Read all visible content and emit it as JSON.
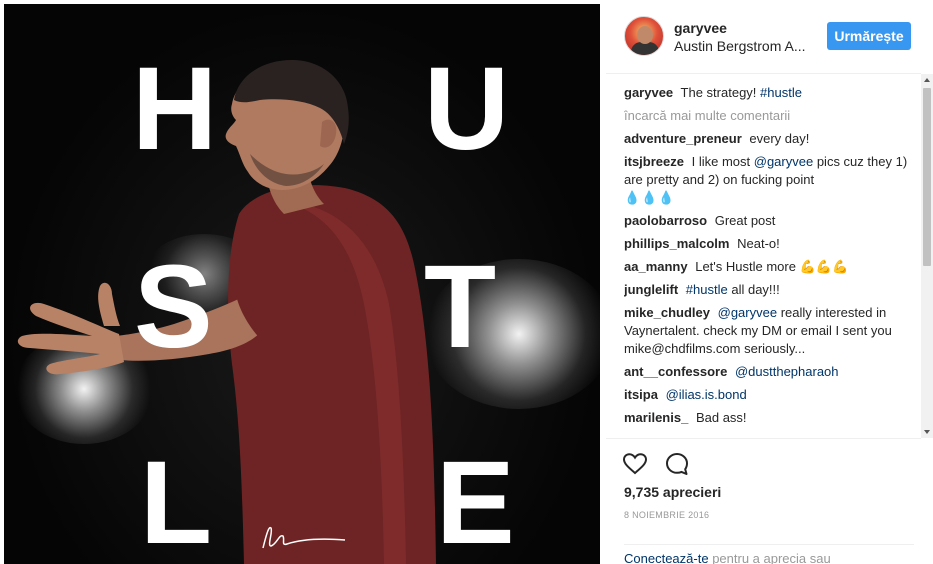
{
  "post": {
    "hustle_letters": [
      "H",
      "U",
      "S",
      "T",
      "L",
      "E"
    ]
  },
  "header": {
    "username": "garyvee",
    "location": "Austin Bergstrom A...",
    "follow_label": "Urmărește"
  },
  "caption": {
    "user": "garyvee",
    "text": "The strategy!",
    "hashtag": "#hustle"
  },
  "load_more_label": "încarcă mai multe comentarii",
  "comments": [
    {
      "user": "adventure_preneur",
      "text": "every day!"
    },
    {
      "user": "itsjbreeze",
      "text_before": "I like most",
      "mention": "@garyvee",
      "text_after": "pics cuz they 1) are pretty and 2) on fucking point",
      "emoji": "💧💧💧"
    },
    {
      "user": "paolobarroso",
      "text": "Great post"
    },
    {
      "user": "phillips_malcolm",
      "text": "Neat-o!"
    },
    {
      "user": "aa_manny",
      "text": "Let's Hustle more",
      "emoji": "💪💪💪"
    },
    {
      "user": "junglelift",
      "mention": "#hustle",
      "text": "all day!!!"
    },
    {
      "user": "mike_chudley",
      "mention": "@garyvee",
      "text": "really interested in Vaynertalent. check my DM or email I sent you mike@chdfilms.com seriously..."
    },
    {
      "user": "ant__confessore",
      "mention": "@dustthepharaoh"
    },
    {
      "user": "itsipa",
      "mention": "@ilias.is.bond"
    },
    {
      "user": "marilenis_",
      "text": "Bad ass!"
    }
  ],
  "actions": {
    "like_icon": "heart-icon",
    "comment_icon": "comment-icon",
    "likes_text": "9,735 aprecieri",
    "date_text": "8 NOIEMBRIE 2016"
  },
  "login_prompt": {
    "link": "Conectează-te",
    "text": "pentru a aprecia sau"
  },
  "colors": {
    "accent": "#3897f0",
    "mention": "#003569",
    "muted": "#999999",
    "photo_bg": "#0a0a0a",
    "shirt": "#7a2a2a"
  }
}
